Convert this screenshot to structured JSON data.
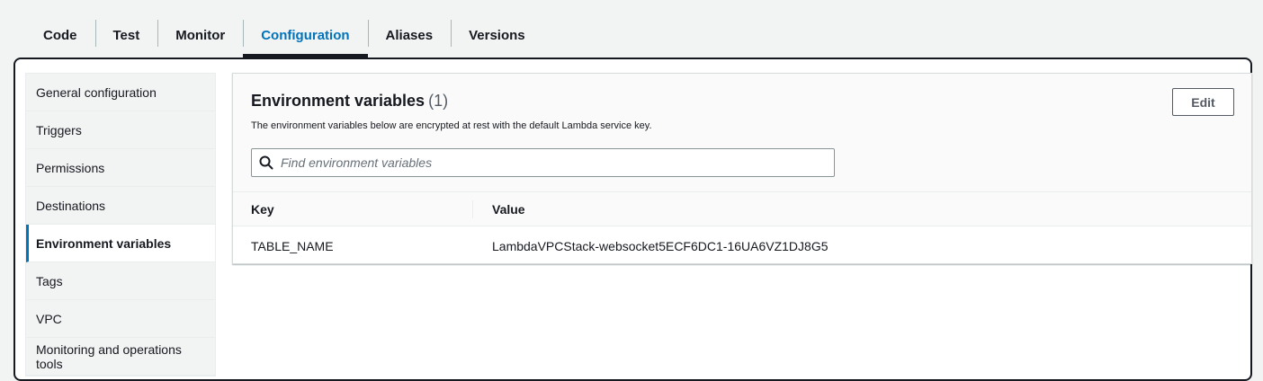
{
  "tabs": [
    {
      "label": "Code",
      "active": false
    },
    {
      "label": "Test",
      "active": false
    },
    {
      "label": "Monitor",
      "active": false
    },
    {
      "label": "Configuration",
      "active": true
    },
    {
      "label": "Aliases",
      "active": false
    },
    {
      "label": "Versions",
      "active": false
    }
  ],
  "sidenav": {
    "items": [
      {
        "label": "General configuration"
      },
      {
        "label": "Triggers"
      },
      {
        "label": "Permissions"
      },
      {
        "label": "Destinations"
      },
      {
        "label": "Environment variables",
        "active": true
      },
      {
        "label": "Tags"
      },
      {
        "label": "VPC"
      },
      {
        "label": "Monitoring and operations tools"
      }
    ]
  },
  "env_vars": {
    "title": "Environment variables",
    "count": "(1)",
    "description": "The environment variables below are encrypted at rest with the default Lambda service key.",
    "edit_label": "Edit",
    "search_placeholder": "Find environment variables",
    "search_value": "",
    "columns": {
      "key": "Key",
      "value": "Value"
    },
    "rows": [
      {
        "key": "TABLE_NAME",
        "value": "LambdaVPCStack-websocket5ECF6DC1-16UA6VZ1DJ8G5"
      }
    ]
  },
  "colors": {
    "accent": "#0073bb",
    "text": "#16191f",
    "background": "#f2f3f3"
  },
  "icons": {
    "search": "search-icon"
  }
}
